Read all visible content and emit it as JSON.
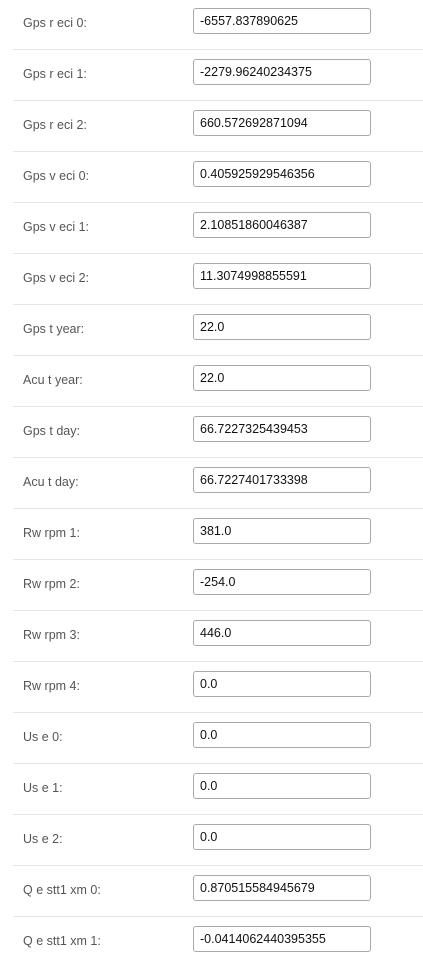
{
  "fields": [
    {
      "label": "Gps r eci 0:",
      "value": "-6557.837890625"
    },
    {
      "label": "Gps r eci 1:",
      "value": "-2279.96240234375"
    },
    {
      "label": "Gps r eci 2:",
      "value": "660.572692871094"
    },
    {
      "label": "Gps v eci 0:",
      "value": "0.405925929546356"
    },
    {
      "label": "Gps v eci 1:",
      "value": "2.10851860046387"
    },
    {
      "label": "Gps v eci 2:",
      "value": "11.3074998855591"
    },
    {
      "label": "Gps t year:",
      "value": "22.0"
    },
    {
      "label": "Acu t year:",
      "value": "22.0"
    },
    {
      "label": "Gps t day:",
      "value": "66.7227325439453"
    },
    {
      "label": "Acu t day:",
      "value": "66.7227401733398"
    },
    {
      "label": "Rw rpm 1:",
      "value": "381.0"
    },
    {
      "label": "Rw rpm 2:",
      "value": "-254.0"
    },
    {
      "label": "Rw rpm 3:",
      "value": "446.0"
    },
    {
      "label": "Rw rpm 4:",
      "value": "0.0"
    },
    {
      "label": "Us e 0:",
      "value": "0.0"
    },
    {
      "label": "Us e 1:",
      "value": "0.0"
    },
    {
      "label": "Us e 2:",
      "value": "0.0"
    },
    {
      "label": "Q e stt1 xm 0:",
      "value": "0.870515584945679"
    },
    {
      "label": "Q e stt1 xm 1:",
      "value": "-0.0414062440395355"
    }
  ]
}
